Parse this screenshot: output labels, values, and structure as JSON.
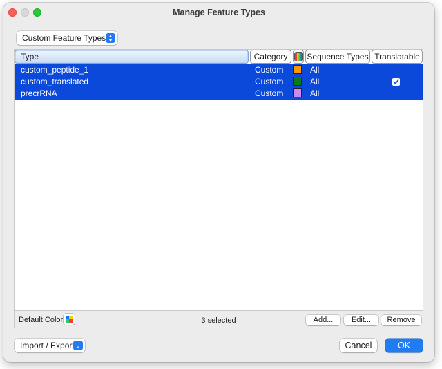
{
  "window": {
    "title": "Manage Feature Types"
  },
  "filter_popup": {
    "selected": "Custom Feature Types"
  },
  "table": {
    "columns": {
      "type": "Type",
      "category": "Category",
      "color_icon": "color-wheel-icon",
      "sequence_types": "Sequence Types",
      "translatable": "Translatable"
    },
    "rows": [
      {
        "type": "custom_peptide_1",
        "category": "Custom",
        "color": "#ff9500",
        "sequence_types": "All",
        "translatable": false
      },
      {
        "type": "custom_translated",
        "category": "Custom",
        "color": "#0a7a1c",
        "sequence_types": "All",
        "translatable": true
      },
      {
        "type": "precrRNA",
        "category": "Custom",
        "color": "#cc88f2",
        "sequence_types": "All",
        "translatable": false
      }
    ],
    "selection_color": "#0a49d9"
  },
  "footer": {
    "default_color_label": "Default Color:",
    "status": "3 selected",
    "add_label": "Add...",
    "edit_label": "Edit...",
    "remove_label": "Remove"
  },
  "bottom": {
    "import_export_label": "Import / Export",
    "cancel_label": "Cancel",
    "ok_label": "OK"
  },
  "colors": {
    "accent": "#1f7cf2"
  }
}
